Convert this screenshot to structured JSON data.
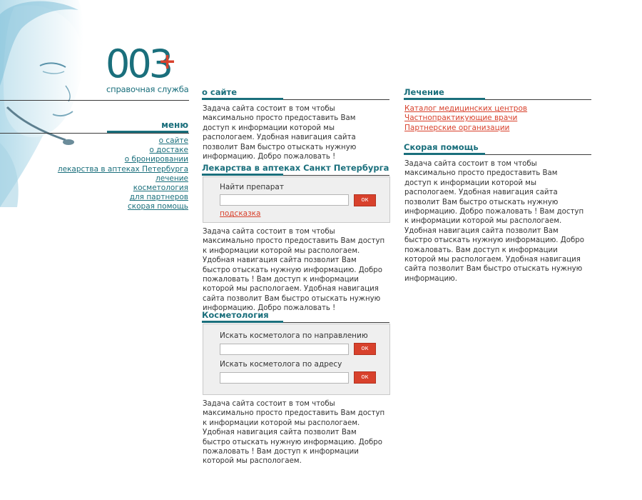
{
  "logo": {
    "digits": "003",
    "tagline": "справочная служба"
  },
  "menu": {
    "title": "меню",
    "items": [
      {
        "label": "о сайте"
      },
      {
        "label": "о достаке"
      },
      {
        "label": "о бронировании"
      },
      {
        "label": "лекарства в аптеках Петербурга"
      },
      {
        "label": "лечение"
      },
      {
        "label": "косметология"
      },
      {
        "label": "для партнеров"
      },
      {
        "label": "скорая помощь"
      }
    ]
  },
  "about": {
    "title": "о сайте",
    "text": "Задача сайта состоит в том чтобы максимально просто предоставить Вам доступ к информации которой мы распологаем. Удобная навигация сайта позволит Вам быстро отыскать нужную информацию. Добро пожаловать !"
  },
  "pharmacy": {
    "title": "Лекарства в аптеках Санкт Петербурга",
    "search_label": "Найти препарат",
    "search_value": "",
    "ok_label": "ок",
    "hint_label": "подсказка",
    "text": "Задача сайта состоит в том чтобы максимально просто предоставить Вам доступ к информации которой мы распологаем. Удобная навигация сайта позволит Вам быстро отыскать нужную информацию. Добро пожаловать !  Вам доступ к информации которой мы распологаем. Удобная навигация сайта позволит Вам быстро отыскать нужную информацию. Добро пожаловать !"
  },
  "cosmetology": {
    "title": "Косметология",
    "direction_label": "Искать косметолога по направлению",
    "direction_value": "",
    "address_label": "Искать косметолога по адресу",
    "address_value": "",
    "ok_label": "ок",
    "text": "Задача сайта состоит в том чтобы максимально просто предоставить Вам доступ к информации которой мы распологаем. Удобная навигация сайта позволит Вам быстро отыскать нужную информацию. Добро пожаловать !  Вам доступ к информации которой мы распологаем."
  },
  "treatment": {
    "title": "Лечение",
    "links": [
      {
        "label": "Каталог медицинских центров"
      },
      {
        "label": "Частнопрактикующие врачи"
      },
      {
        "label": "Партнерские организации"
      }
    ]
  },
  "emergency": {
    "title": "Скорая помощь",
    "text": "Задача сайта состоит в том чтобы максимально просто предоставить Вам доступ к информации которой мы распологаем. Удобная навигация сайта позволит Вам быстро отыскать нужную информацию. Добро пожаловать !  Вам доступ к информации которой мы распологаем. Удобная навигация сайта позволит Вам быстро отыскать нужную информацию. Добро пожаловать. Вам доступ к информации которой мы распологаем. Удобная навигация сайта позволит Вам быстро отыскать нужную информацию."
  },
  "colors": {
    "brand_teal": "#1a6f7c",
    "accent_red": "#d8412c",
    "box_gray": "#efefef"
  }
}
